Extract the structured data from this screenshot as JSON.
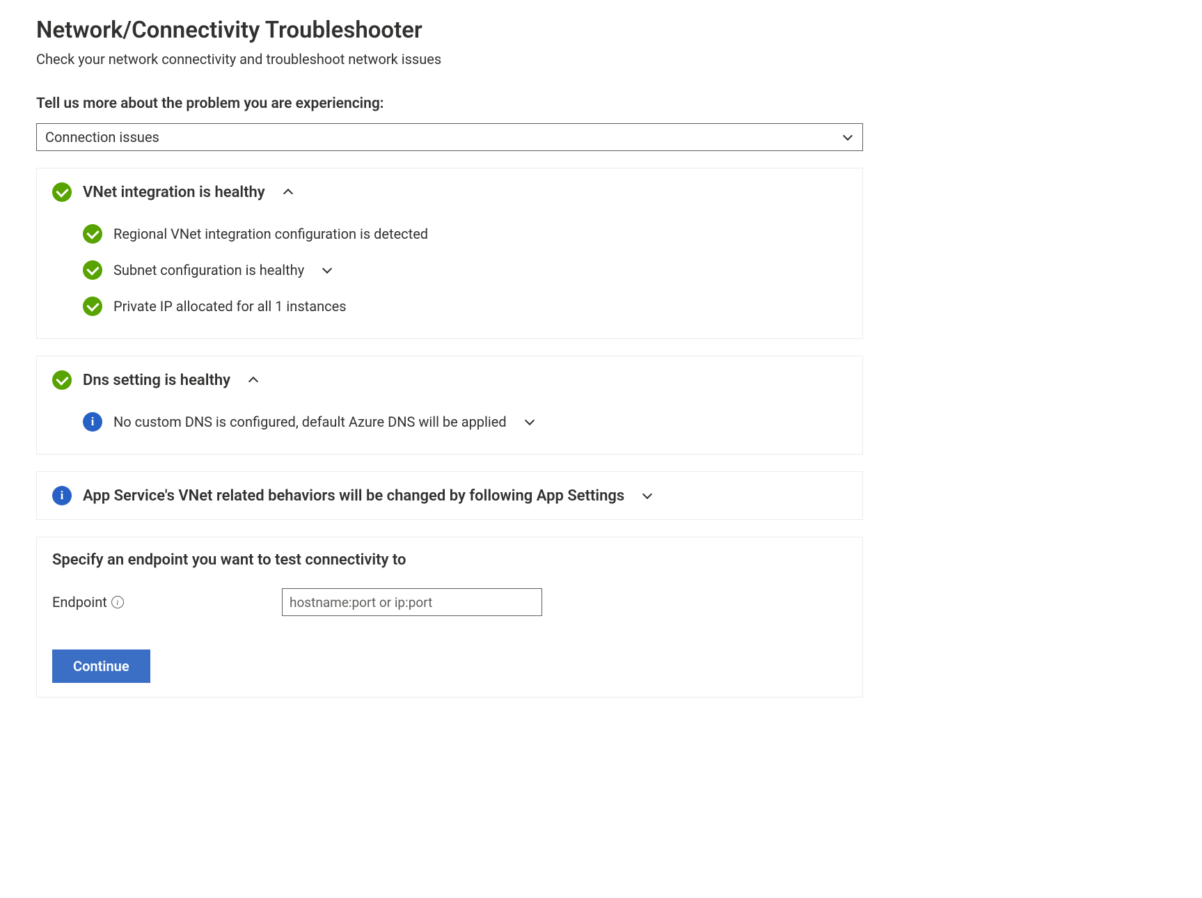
{
  "header": {
    "title": "Network/Connectivity Troubleshooter",
    "subtitle": "Check your network connectivity and troubleshoot network issues"
  },
  "prompt": {
    "label": "Tell us more about the problem you are experiencing:",
    "selected": "Connection issues"
  },
  "panels": {
    "vnet": {
      "title": "VNet integration is healthy",
      "items": [
        {
          "text": "Regional VNet integration configuration is detected",
          "icon": "success",
          "expandable": false
        },
        {
          "text": "Subnet configuration is healthy",
          "icon": "success",
          "expandable": true
        },
        {
          "text": "Private IP allocated for all 1 instances",
          "icon": "success",
          "expandable": false
        }
      ]
    },
    "dns": {
      "title": "Dns setting is healthy",
      "items": [
        {
          "text": "No custom DNS is configured, default Azure DNS will be applied",
          "icon": "info",
          "expandable": true
        }
      ]
    },
    "appsettings": {
      "title": "App Service's VNet related behaviors will be changed by following App Settings"
    }
  },
  "endpoint_form": {
    "section_title": "Specify an endpoint you want to test connectivity to",
    "label": "Endpoint",
    "placeholder": "hostname:port or ip:port",
    "value": "",
    "button": "Continue"
  }
}
